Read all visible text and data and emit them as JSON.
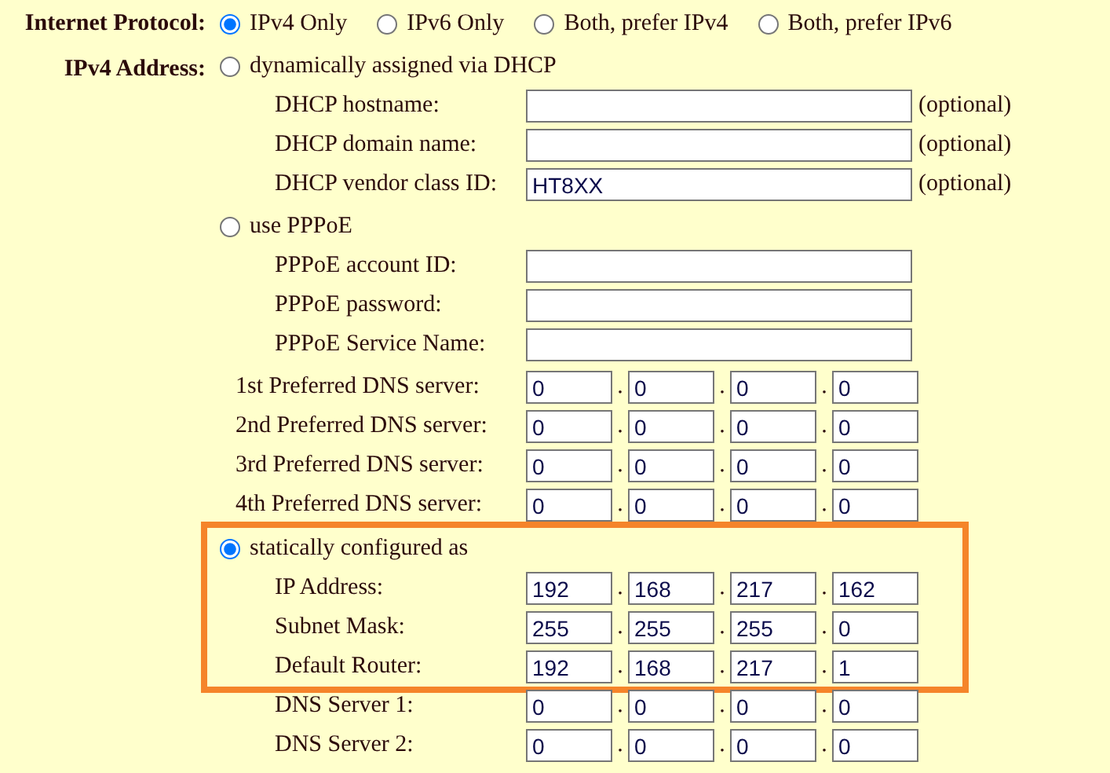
{
  "internet_protocol": {
    "label": "Internet Protocol:",
    "options": [
      {
        "label": "IPv4 Only",
        "selected": true
      },
      {
        "label": "IPv6 Only",
        "selected": false
      },
      {
        "label": "Both, prefer IPv4",
        "selected": false
      },
      {
        "label": "Both, prefer IPv6",
        "selected": false
      }
    ]
  },
  "ipv4_address": {
    "label": "IPv4 Address:",
    "groups": [
      {
        "option": {
          "label": "dynamically assigned via DHCP",
          "selected": false
        },
        "highlighted": false,
        "rows": [
          {
            "kind": "text",
            "label": "DHCP hostname:",
            "value": "",
            "note": "(optional)"
          },
          {
            "kind": "text",
            "label": "DHCP domain name:",
            "value": "",
            "note": "(optional)"
          },
          {
            "kind": "text",
            "label": "DHCP vendor class ID:",
            "value": "HT8XX",
            "note": "(optional)"
          }
        ]
      },
      {
        "option": {
          "label": "use PPPoE",
          "selected": false
        },
        "highlighted": false,
        "rows": [
          {
            "kind": "text",
            "label": "PPPoE account ID:",
            "value": ""
          },
          {
            "kind": "text",
            "label": "PPPoE password:",
            "value": ""
          },
          {
            "kind": "text",
            "label": "PPPoE Service Name:",
            "value": ""
          }
        ]
      },
      {
        "highlighted": false,
        "rows": [
          {
            "kind": "dns",
            "label": "1st Preferred DNS server:",
            "octets": [
              "0",
              "0",
              "0",
              "0"
            ],
            "dots": [
              ".",
              ".",
              "."
            ]
          },
          {
            "kind": "dns",
            "label": "2nd Preferred DNS server:",
            "octets": [
              "0",
              "0",
              "0",
              "0"
            ],
            "dots": [
              ".",
              ".",
              "."
            ]
          },
          {
            "kind": "dns",
            "label": "3rd Preferred DNS server:",
            "octets": [
              "0",
              "0",
              "0",
              "0"
            ],
            "dots": [
              ".",
              ".",
              "."
            ]
          },
          {
            "kind": "dns",
            "label": "4th Preferred DNS server:",
            "octets": [
              "0",
              "0",
              "0",
              "0"
            ],
            "dots": [
              ".",
              ".",
              "."
            ]
          }
        ]
      },
      {
        "option": {
          "label": "statically configured as",
          "selected": true
        },
        "highlighted": true,
        "rows": [
          {
            "kind": "ip",
            "label": "IP Address:",
            "octets": [
              "192",
              "168",
              "217",
              "162"
            ],
            "dots": [
              ".",
              ".",
              "."
            ]
          },
          {
            "kind": "ip",
            "label": "Subnet Mask:",
            "octets": [
              "255",
              "255",
              "255",
              "0"
            ],
            "dots": [
              ".",
              ".",
              "."
            ]
          },
          {
            "kind": "ip",
            "label": "Default Router:",
            "octets": [
              "192",
              "168",
              "217",
              "1"
            ],
            "dots": [
              ".",
              ".",
              "."
            ]
          }
        ]
      },
      {
        "highlighted": false,
        "rows": [
          {
            "kind": "ip",
            "label": "DNS Server 1:",
            "octets": [
              "0",
              "0",
              "0",
              "0"
            ],
            "dots": [
              ".",
              ".",
              "."
            ]
          },
          {
            "kind": "ip",
            "label": "DNS Server 2:",
            "octets": [
              "0",
              "0",
              "0",
              "0"
            ],
            "dots": [
              ".",
              ".",
              "."
            ]
          }
        ]
      }
    ]
  }
}
